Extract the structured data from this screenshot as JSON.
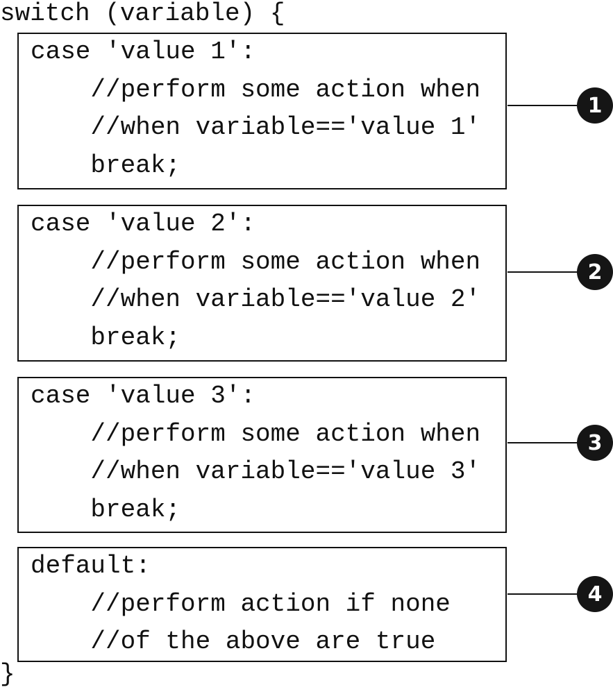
{
  "header": "switch (variable) {",
  "footer": "}",
  "blocks": [
    {
      "lines": [
        "case 'value 1':",
        "    //perform some action when",
        "    //when variable=='value 1'",
        "    break;"
      ],
      "callout": "1"
    },
    {
      "lines": [
        "case 'value 2':",
        "    //perform some action when",
        "    //when variable=='value 2'",
        "    break;"
      ],
      "callout": "2"
    },
    {
      "lines": [
        "case 'value 3':",
        "    //perform some action when",
        "    //when variable=='value 3'",
        "    break;"
      ],
      "callout": "3"
    },
    {
      "lines": [
        "default:",
        "    //perform action if none",
        "    //of the above are true"
      ],
      "callout": "4"
    }
  ],
  "colors": {
    "ink": "#111111",
    "callout_fill": "#151515",
    "callout_text": "#ffffff"
  }
}
